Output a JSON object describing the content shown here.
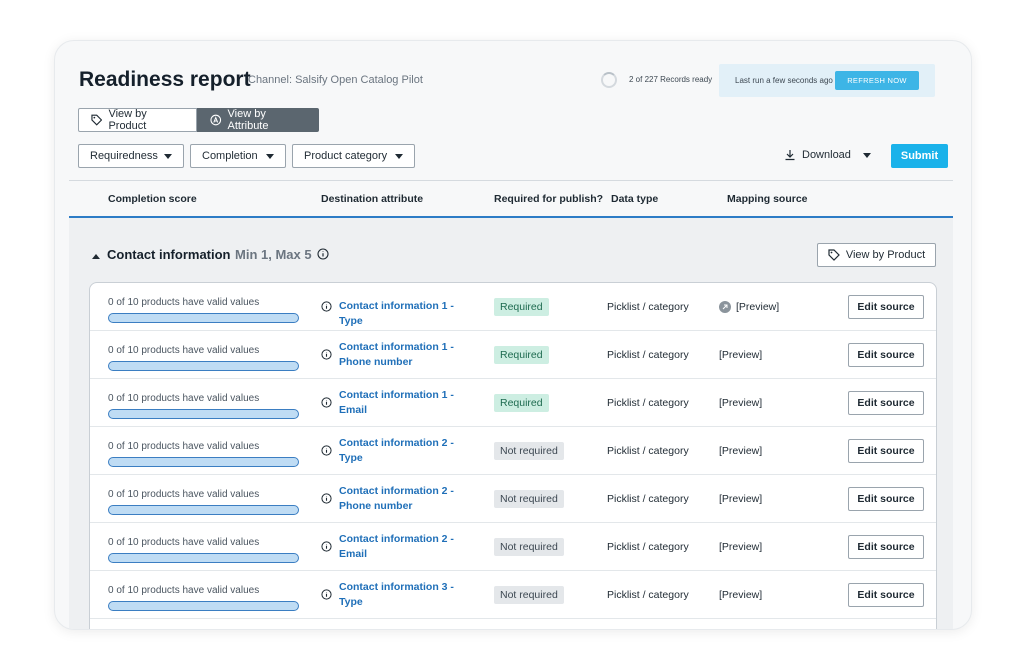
{
  "header": {
    "title": "Readiness report",
    "channel": "Channel: Salsify Open Catalog Pilot",
    "records_status": "2 of 227 Records ready",
    "last_run": "Last run a few seconds ago",
    "refresh_label": "REFRESH NOW",
    "refresh_color": "#3db5e6"
  },
  "view_toggle": {
    "by_product": "View by Product",
    "by_attribute": "View by Attribute",
    "active": "by_attribute"
  },
  "filters": {
    "requiredness": "Requiredness",
    "completion": "Completion",
    "product_category": "Product category"
  },
  "toolbar": {
    "download_label": "Download",
    "submit_label": "Submit",
    "submit_color": "#1ab2ea"
  },
  "columns": {
    "completion_score": "Completion score",
    "destination_attribute": "Destination attribute",
    "required_for_publish": "Required for publish?",
    "data_type": "Data type",
    "mapping_source": "Mapping source"
  },
  "section": {
    "title": "Contact information",
    "min_max": "Min 1, Max 5",
    "view_by_product_label": "View by Product"
  },
  "rows": [
    {
      "completion": "0 of 10 products have valid values",
      "progress": 0,
      "attr_line1": "Contact information 1 - Type",
      "attr_line2": "",
      "required": "Required",
      "required_status": "required",
      "data_type": "Picklist / category",
      "mapping": "[Preview]",
      "mapping_icon": "mapping-icon",
      "edit_label": "Edit source"
    },
    {
      "completion": "0 of 10 products have valid values",
      "progress": 0,
      "attr_line1": "Contact information 1 -",
      "attr_line2": "Phone number",
      "required": "Required",
      "required_status": "required",
      "data_type": "Picklist / category",
      "mapping": "[Preview]",
      "mapping_icon": "",
      "edit_label": "Edit source"
    },
    {
      "completion": "0 of 10 products have valid values",
      "progress": 0,
      "attr_line1": "Contact information 1 -",
      "attr_line2": "Email",
      "required": "Required",
      "required_status": "required",
      "data_type": "Picklist / category",
      "mapping": "[Preview]",
      "mapping_icon": "",
      "edit_label": "Edit source"
    },
    {
      "completion": "0 of 10 products have valid values",
      "progress": 0,
      "attr_line1": "Contact information 2 -",
      "attr_line2": "Type",
      "required": "Not required",
      "required_status": "not_required",
      "data_type": "Picklist / category",
      "mapping": "[Preview]",
      "mapping_icon": "",
      "edit_label": "Edit source"
    },
    {
      "completion": "0 of 10 products have valid values",
      "progress": 0,
      "attr_line1": "Contact information 2 -",
      "attr_line2": "Phone number",
      "required": "Not required",
      "required_status": "not_required",
      "data_type": "Picklist / category",
      "mapping": "[Preview]",
      "mapping_icon": "",
      "edit_label": "Edit source"
    },
    {
      "completion": "0 of 10 products have valid values",
      "progress": 0,
      "attr_line1": "Contact information 2 -",
      "attr_line2": "Email",
      "required": "Not required",
      "required_status": "not_required",
      "data_type": "Picklist / category",
      "mapping": "[Preview]",
      "mapping_icon": "",
      "edit_label": "Edit source"
    },
    {
      "completion": "0 of 10 products have valid values",
      "progress": 0,
      "attr_line1": "Contact information 3 -",
      "attr_line2": "Type",
      "required": "Not required",
      "required_status": "not_required",
      "data_type": "Picklist / category",
      "mapping": "[Preview]",
      "mapping_icon": "",
      "edit_label": "Edit source"
    }
  ]
}
